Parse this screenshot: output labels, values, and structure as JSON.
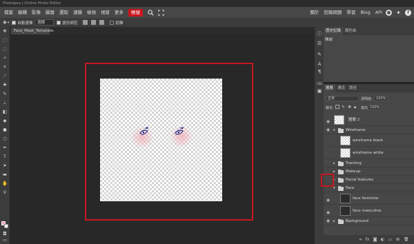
{
  "window": {
    "title": "Photopea | Online Photo Editor"
  },
  "menubar": {
    "items": [
      "檔案",
      "編輯",
      "影像",
      "圖層",
      "選取",
      "濾鏡",
      "檢視",
      "視窗",
      "更多"
    ],
    "active_item": "帳號",
    "right_items": [
      "關於",
      "回報問題",
      "學習",
      "Blog",
      "API"
    ]
  },
  "options_bar": {
    "auto_select_label": "自動選擇",
    "auto_select_target": "圖層",
    "transform_controls_label": "變形調控",
    "distance_label": "距離"
  },
  "document": {
    "tab_label": "Face_Mask_Template.",
    "tab_close": "×"
  },
  "panels": {
    "top_tabs": [
      "歷史記錄",
      "顏色板"
    ],
    "history_item": "開啟",
    "layer_tabs": [
      "圖層",
      "通道",
      "路徑"
    ],
    "blend_mode": "正常",
    "opacity_label": "透明度:",
    "opacity_value": "100%",
    "lock_label": "鎖定:",
    "fill_label": "填充:",
    "fill_value": "100%"
  },
  "layers": [
    {
      "name": "圖層 2",
      "kind": "layer",
      "visible": true
    },
    {
      "name": "Wireframe",
      "kind": "group-open",
      "visible": true
    },
    {
      "name": "wireframe black",
      "kind": "layer",
      "visible": false
    },
    {
      "name": "wireframe white",
      "kind": "layer",
      "visible": false
    },
    {
      "name": "Tracking",
      "kind": "group",
      "visible": false
    },
    {
      "name": "Makeup",
      "kind": "group",
      "visible": false
    },
    {
      "name": "Facial features",
      "kind": "group",
      "visible": false
    },
    {
      "name": "Face",
      "kind": "group-open",
      "visible": false
    },
    {
      "name": "face feminine",
      "kind": "layer",
      "visible": true
    },
    {
      "name": "face masculine",
      "kind": "layer",
      "visible": true
    },
    {
      "name": "Background",
      "kind": "group",
      "visible": true
    }
  ],
  "colors": {
    "accent": "#c8171e",
    "foreground_swatch": "#f4a9b4",
    "background_swatch": "#ffffff"
  }
}
